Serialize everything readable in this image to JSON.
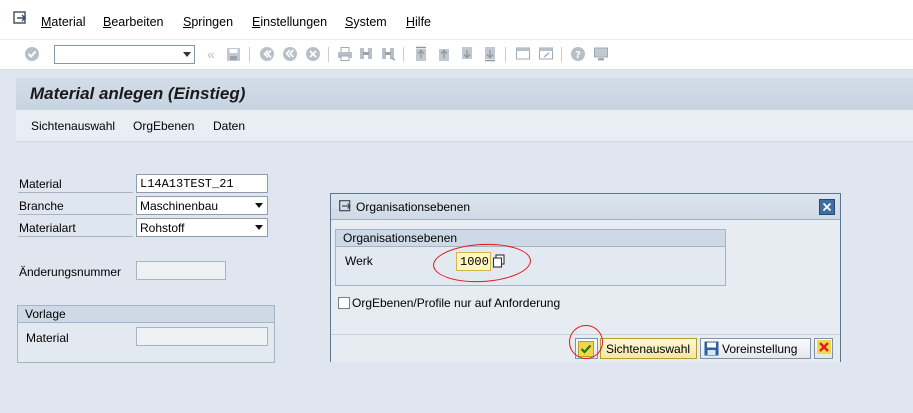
{
  "menubar": {
    "items": [
      {
        "first": "M",
        "rest": "aterial"
      },
      {
        "first": "B",
        "rest": "earbeiten"
      },
      {
        "first": "S",
        "rest": "pringen"
      },
      {
        "first": "E",
        "rest": "instellungen"
      },
      {
        "first": "S",
        "rest": "ystem"
      },
      {
        "first": "H",
        "rest": "ilfe"
      }
    ]
  },
  "toolbar": {
    "command_field_value": "",
    "icons": [
      "enter-icon",
      "save-icon",
      "back-icon",
      "exit-icon",
      "cancel-icon",
      "print-icon",
      "find-icon",
      "find-next-icon",
      "first-page-icon",
      "prev-page-icon",
      "next-page-icon",
      "last-page-icon",
      "new-session-icon",
      "shortcut-icon",
      "help-icon",
      "layout-icon"
    ]
  },
  "title": "Material anlegen (Einstieg)",
  "app_toolbar": {
    "buttons": [
      "Sichtenauswahl",
      "OrgEbenen",
      "Daten"
    ]
  },
  "form": {
    "material_label": "Material",
    "material_value": "L14A13TEST_21",
    "branche_label": "Branche",
    "branche_value": "Maschinenbau",
    "materialart_label": "Materialart",
    "materialart_value": "Rohstoff",
    "aenderungsnummer_label": "Änderungsnummer",
    "aenderungsnummer_value": "",
    "vorlage_title": "Vorlage",
    "vorlage_material_label": "Material",
    "vorlage_material_value": ""
  },
  "dialog": {
    "title": "Organisationsebenen",
    "group_title": "Organisationsebenen",
    "werk_label": "Werk",
    "werk_value": "1000",
    "checkbox_label": "OrgEbenen/Profile nur auf Anforderung",
    "checkbox_checked": false,
    "buttons": {
      "sichtenauswahl": "Sichtenauswahl",
      "voreinstellung": "Voreinstellung"
    }
  },
  "colors": {
    "annotation_red": "#e01818",
    "title_bar": "#c6d3e1",
    "highlight_field": "#fff7bf"
  }
}
